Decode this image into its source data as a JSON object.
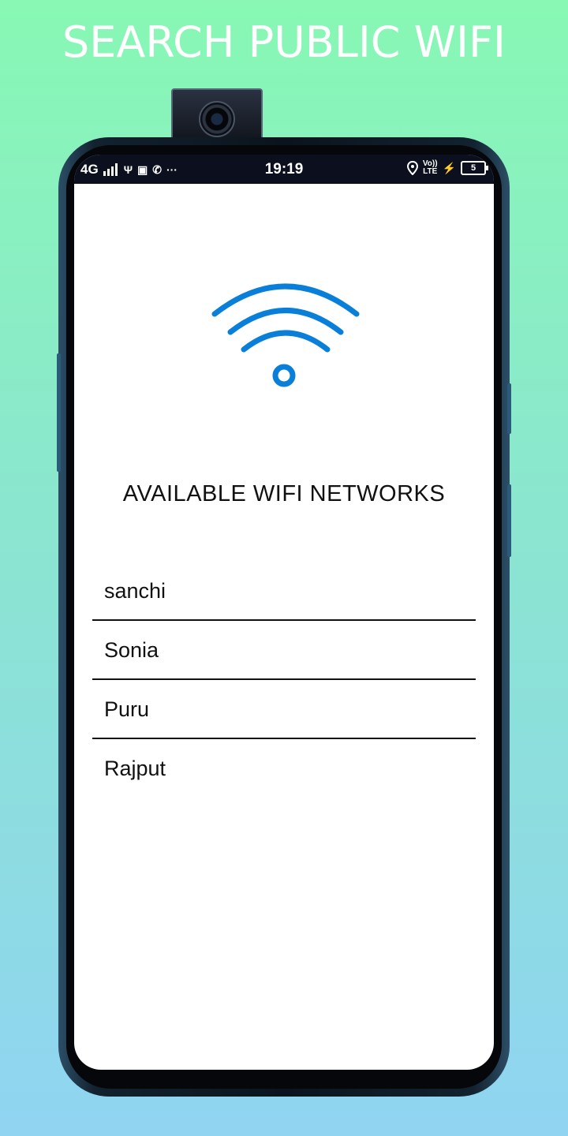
{
  "banner": {
    "title": "SEARCH PUBLIC WIFI"
  },
  "status_bar": {
    "network": "4G",
    "time": "19:19",
    "volte": "Vo))",
    "lte": "LTE",
    "battery": "5"
  },
  "main": {
    "icon": "wifi-icon",
    "accent_color": "#0a7fd9",
    "title": "AVAILABLE WIFI NETWORKS",
    "networks": [
      {
        "name": "sanchi"
      },
      {
        "name": "Sonia"
      },
      {
        "name": "Puru"
      },
      {
        "name": "Rajput"
      }
    ]
  }
}
